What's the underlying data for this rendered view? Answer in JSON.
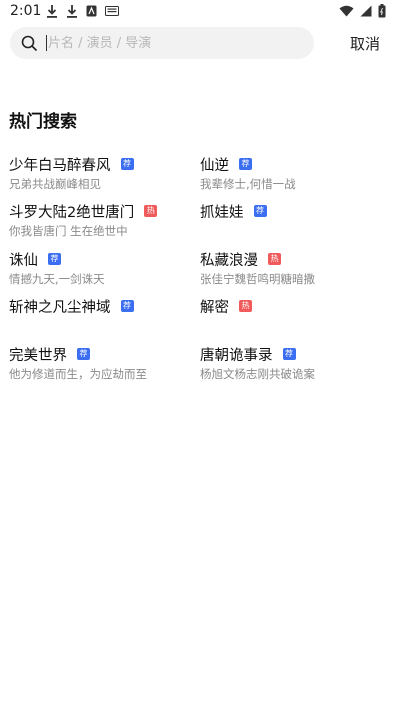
{
  "status": {
    "time": "2:01",
    "left_icons": [
      "download-icon",
      "download-icon",
      "app-icon",
      "keyboard-icon"
    ],
    "right_icons": [
      "wifi-icon",
      "signal-icon",
      "battery-icon"
    ]
  },
  "search": {
    "placeholder": "片名 / 演员 / 导演",
    "value": "",
    "cancel_label": "取消"
  },
  "hot": {
    "title": "热门搜索",
    "items": [
      {
        "title": "少年白马醉春风",
        "badge": "荐",
        "badge_type": "rec",
        "subtitle": "兄弟共战巅峰相见"
      },
      {
        "title": "仙逆",
        "badge": "荐",
        "badge_type": "rec",
        "subtitle": "我辈修士,何惜一战"
      },
      {
        "title": "斗罗大陆2绝世唐门",
        "badge": "热",
        "badge_type": "hot",
        "subtitle": "你我皆唐门 生在绝世中"
      },
      {
        "title": "抓娃娃",
        "badge": "荐",
        "badge_type": "rec",
        "subtitle": ""
      },
      {
        "title": "诛仙",
        "badge": "荐",
        "badge_type": "rec",
        "subtitle": "情撼九天,一剑诛天"
      },
      {
        "title": "私藏浪漫",
        "badge": "热",
        "badge_type": "hot",
        "subtitle": "张佳宁魏哲鸣明糖暗撒"
      },
      {
        "title": "斩神之凡尘神域",
        "badge": "荐",
        "badge_type": "rec",
        "subtitle": ""
      },
      {
        "title": "解密",
        "badge": "热",
        "badge_type": "hot",
        "subtitle": ""
      },
      {
        "title": "完美世界",
        "badge": "荐",
        "badge_type": "rec",
        "subtitle": "他为修道而生，为应劫而至"
      },
      {
        "title": "唐朝诡事录",
        "badge": "荐",
        "badge_type": "rec",
        "subtitle": "杨旭文杨志刚共破诡案"
      }
    ]
  },
  "colors": {
    "rec_badge": "#3b6ef0",
    "hot_badge": "#f05a5a"
  }
}
